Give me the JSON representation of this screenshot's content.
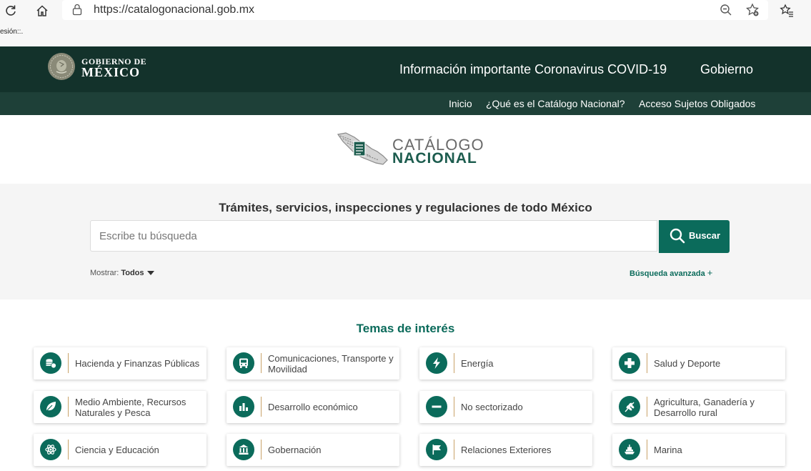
{
  "browser": {
    "url": "https://catalogonacional.gob.mx",
    "strip_text": "esión::."
  },
  "header": {
    "logo_line1": "GOBIERNO DE",
    "logo_line2": "MÉXICO",
    "links": [
      "Información importante Coronavirus COVID-19",
      "Gobierno"
    ]
  },
  "subnav": {
    "links": [
      "Inicio",
      "¿Qué es el Catálogo Nacional?",
      "Acceso Sujetos Obligados"
    ]
  },
  "brand": {
    "line1": "CATÁLOGO",
    "line2": "NACIONAL"
  },
  "search": {
    "heading": "Trámites, servicios, inspecciones y regulaciones de todo México",
    "placeholder": "Escribe tu búsqueda",
    "button": "Buscar",
    "show_label": "Mostrar:",
    "show_value": "Todos",
    "advanced": "Búsqueda avanzada",
    "advanced_plus": "+"
  },
  "temas": {
    "title": "Temas de interés",
    "items": [
      {
        "label": "Hacienda y Finanzas Públicas",
        "icon": "coins-icon"
      },
      {
        "label": "Comunicaciones, Transporte y Movilidad",
        "icon": "bus-icon"
      },
      {
        "label": "Energía",
        "icon": "lightning-icon"
      },
      {
        "label": "Salud y Deporte",
        "icon": "health-cross-icon"
      },
      {
        "label": "Medio Ambiente, Recursos Naturales y Pesca",
        "icon": "leaf-icon"
      },
      {
        "label": "Desarrollo económico",
        "icon": "bar-chart-icon"
      },
      {
        "label": "No sectorizado",
        "icon": "minus-icon"
      },
      {
        "label": "Agricultura, Ganadería y Desarrollo rural",
        "icon": "wheat-icon"
      },
      {
        "label": "Ciencia y Educación",
        "icon": "atom-icon"
      },
      {
        "label": "Gobernación",
        "icon": "building-icon"
      },
      {
        "label": "Relaciones Exteriores",
        "icon": "flag-icon"
      },
      {
        "label": "Marina",
        "icon": "ship-icon"
      }
    ]
  },
  "colors": {
    "header_dark": "#13322b",
    "header_sub": "#1e4038",
    "accent": "#0b6b5b",
    "divider_gold": "#c9a36a"
  }
}
